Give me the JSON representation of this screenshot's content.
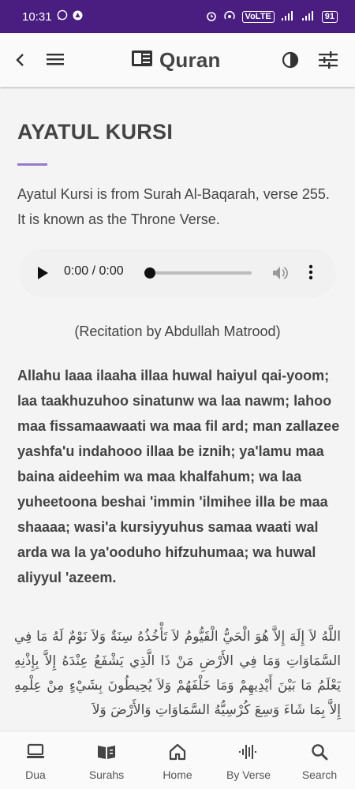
{
  "status_bar": {
    "time": "10:31",
    "network_label": "VoLTE",
    "battery": "91"
  },
  "app_bar": {
    "title": "Quran",
    "icons": [
      "back-arrow-icon",
      "menu-icon",
      "book-icon",
      "contrast-icon",
      "filter-settings-icon"
    ]
  },
  "article": {
    "heading": "AYATUL KURSI",
    "intro": "Ayatul Kursi is from Surah Al-Baqarah, verse 255. It is known as the Throne Verse.",
    "player": {
      "time_display": "0:00 / 0:00",
      "progress": 0
    },
    "recitation_note": "(Recitation by Abdullah Matrood)",
    "transliteration": "Allahu laaa ilaaha illaa huwal haiyul qai-yoom; laa taakhuzuhoo sinatunw wa laa nawm; lahoo maa fissamaawaati wa maa fil ard; man zallazee yashfa'u indahooo illaa be iznih; ya'lamu maa baina aideehim wa maa khalfahum; wa laa yuheetoona beshai 'immin 'ilmihee illa be maa shaaaa; wasi'a kursiyyuhus samaa waati wal arda wa la ya'ooduho hifzuhumaa; wa huwal aliyyul 'azeem.",
    "arabic": "اللَّهُ لاَ إِلَهَ إِلاَّ هُوَ الْحَيُّ الْقَيُّومُ لاَ تَأْخُذُهُ سِنَةٌ وَلاَ نَوْمٌ لَهُ مَا فِي السَّمَاوَاتِ وَمَا فِي الأَرْضِ مَنْ ذَا الَّذِي يَشْفَعُ عِنْدَهُ إِلاَّ بِإِذْنِهِ يَعْلَمُ مَا بَيْنَ أَيْدِيهِمْ وَمَا خَلْفَهُمْ وَلاَ يُحِيطُونَ بِشَيْءٍ مِنْ عِلْمِهِ إِلاَّ بِمَا شَاءَ وَسِعَ كُرْسِيُّهُ السَّمَاوَاتِ وَالأَرْضَ وَلاَ"
  },
  "bottom_nav": [
    {
      "label": "Dua",
      "icon": "laptop-icon"
    },
    {
      "label": "Surahs",
      "icon": "open-book-icon"
    },
    {
      "label": "Home",
      "icon": "home-icon"
    },
    {
      "label": "By Verse",
      "icon": "waveform-icon"
    },
    {
      "label": "Search",
      "icon": "search-icon"
    }
  ],
  "colors": {
    "status_bar": "#4a1e80",
    "accent_line": "#9a79c8",
    "text": "#444444",
    "background": "#f4f4f4"
  }
}
